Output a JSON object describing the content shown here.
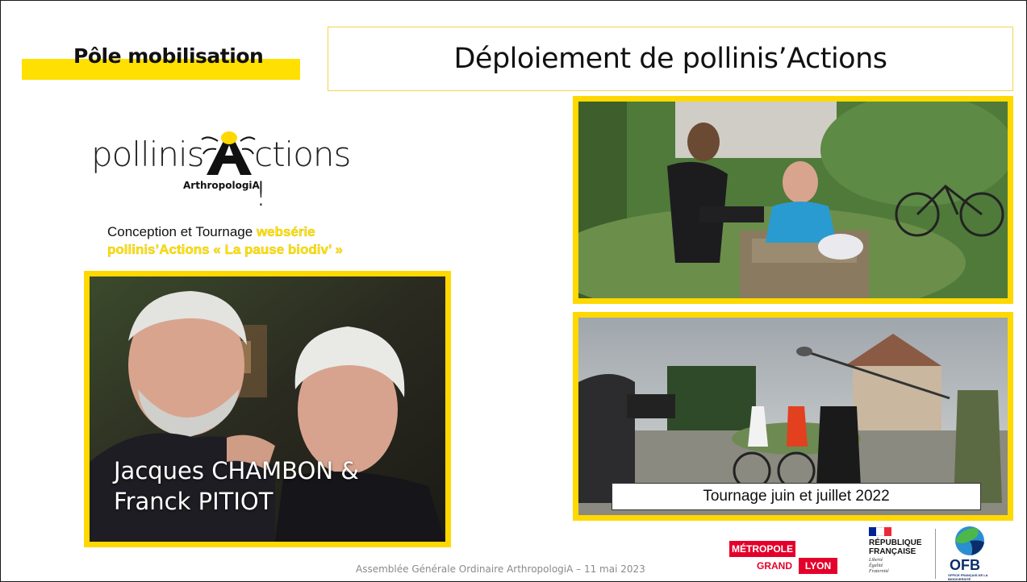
{
  "section": {
    "label": "Pôle mobilisation"
  },
  "title": "Déploiement de pollinis’Actions",
  "logo": {
    "left": "pollinis",
    "right": "ctions !",
    "sub": "ArthropologiA"
  },
  "subtitle": {
    "text": "Conception et Tournage ",
    "highlight_1": "websérie",
    "highlight_2": "pollinis’Actions  « La pause biodiv’ »"
  },
  "photos": {
    "left_names_line1": "Jacques CHAMBON &",
    "left_names_line2": "Franck PITIOT",
    "bottom_caption": "Tournage juin et juillet 2022"
  },
  "footer": "Assemblée Générale Ordinaire ArthropologiA – 11 mai 2023",
  "partners": {
    "metropole_top": "MÉTROPOLE",
    "metropole_grand": "GRAND",
    "metropole_lyon": "LYON",
    "rf_name_1": "RÉPUBLIQUE",
    "rf_name_2": "FRANÇAISE",
    "rf_motto_1": "Liberté",
    "rf_motto_2": "Égalité",
    "rf_motto_3": "Fraternité",
    "ofb": "OFB",
    "ofb_sub": "OFFICE FRANÇAIS DE LA BIODIVERSITÉ"
  },
  "colors": {
    "accent_yellow": "#ffd800",
    "metropole_red": "#e4002b",
    "ofb_blue": "#0b2d6b"
  }
}
